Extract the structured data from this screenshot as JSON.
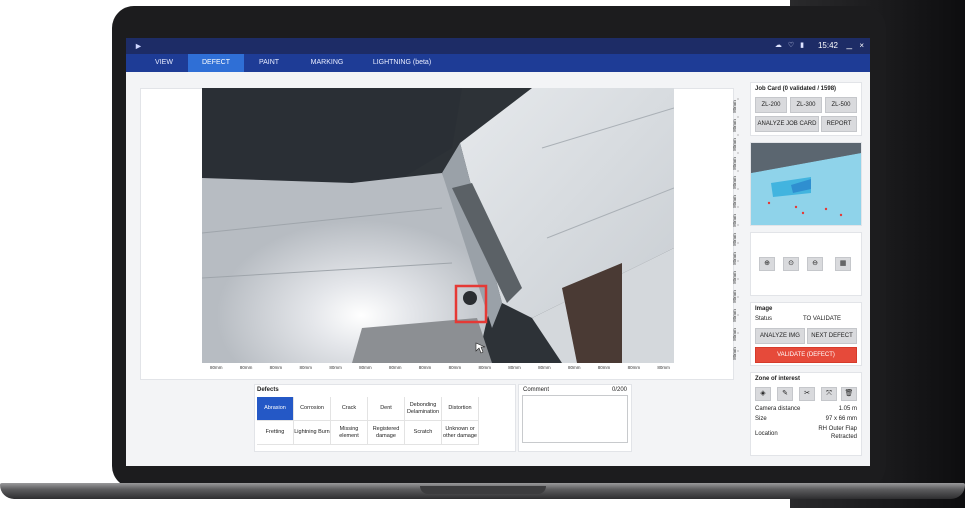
{
  "titlebar": {
    "time": "15:42",
    "min": "_",
    "close": "×"
  },
  "tabs": [
    "VIEW",
    "DEFECT",
    "PAINT",
    "MARKING",
    "LIGHTNING (beta)"
  ],
  "active_tab": "DEFECT",
  "scale_label": "80mm",
  "job_card": {
    "title": "Job Card (0 validated / 1598)",
    "buttons": [
      "ZL-200",
      "ZL-300",
      "ZL-500"
    ],
    "analyze": "ANALYZE JOB CARD",
    "report": "REPORT"
  },
  "image": {
    "heading": "Image",
    "status_label": "Status",
    "status_value": "TO VALIDATE",
    "analyze_img": "ANALYZE IMG",
    "next_defect": "NEXT DEFECT",
    "validate": "VALIDATE (DEFECT)"
  },
  "zone": {
    "heading": "Zone of interest",
    "camera_label": "Camera distance",
    "camera_value": "1.05 m",
    "size_label": "Size",
    "size_value": "97 x 66 mm",
    "location_label": "Location",
    "location_value_1": "RH Outer Flap",
    "location_value_2": "Retracted"
  },
  "defects": {
    "heading": "Defects",
    "row1": [
      "Abrasion",
      "Corrosion",
      "Crack",
      "Dent",
      "Debonding Delamination",
      "Distortion"
    ],
    "row2": [
      "Fretting",
      "Lightning Burn",
      "Missing element",
      "Registered damage",
      "Scratch",
      "Unknown or other damage"
    ],
    "selected": "Abrasion"
  },
  "comment": {
    "label": "Comment",
    "count": "0/200"
  }
}
